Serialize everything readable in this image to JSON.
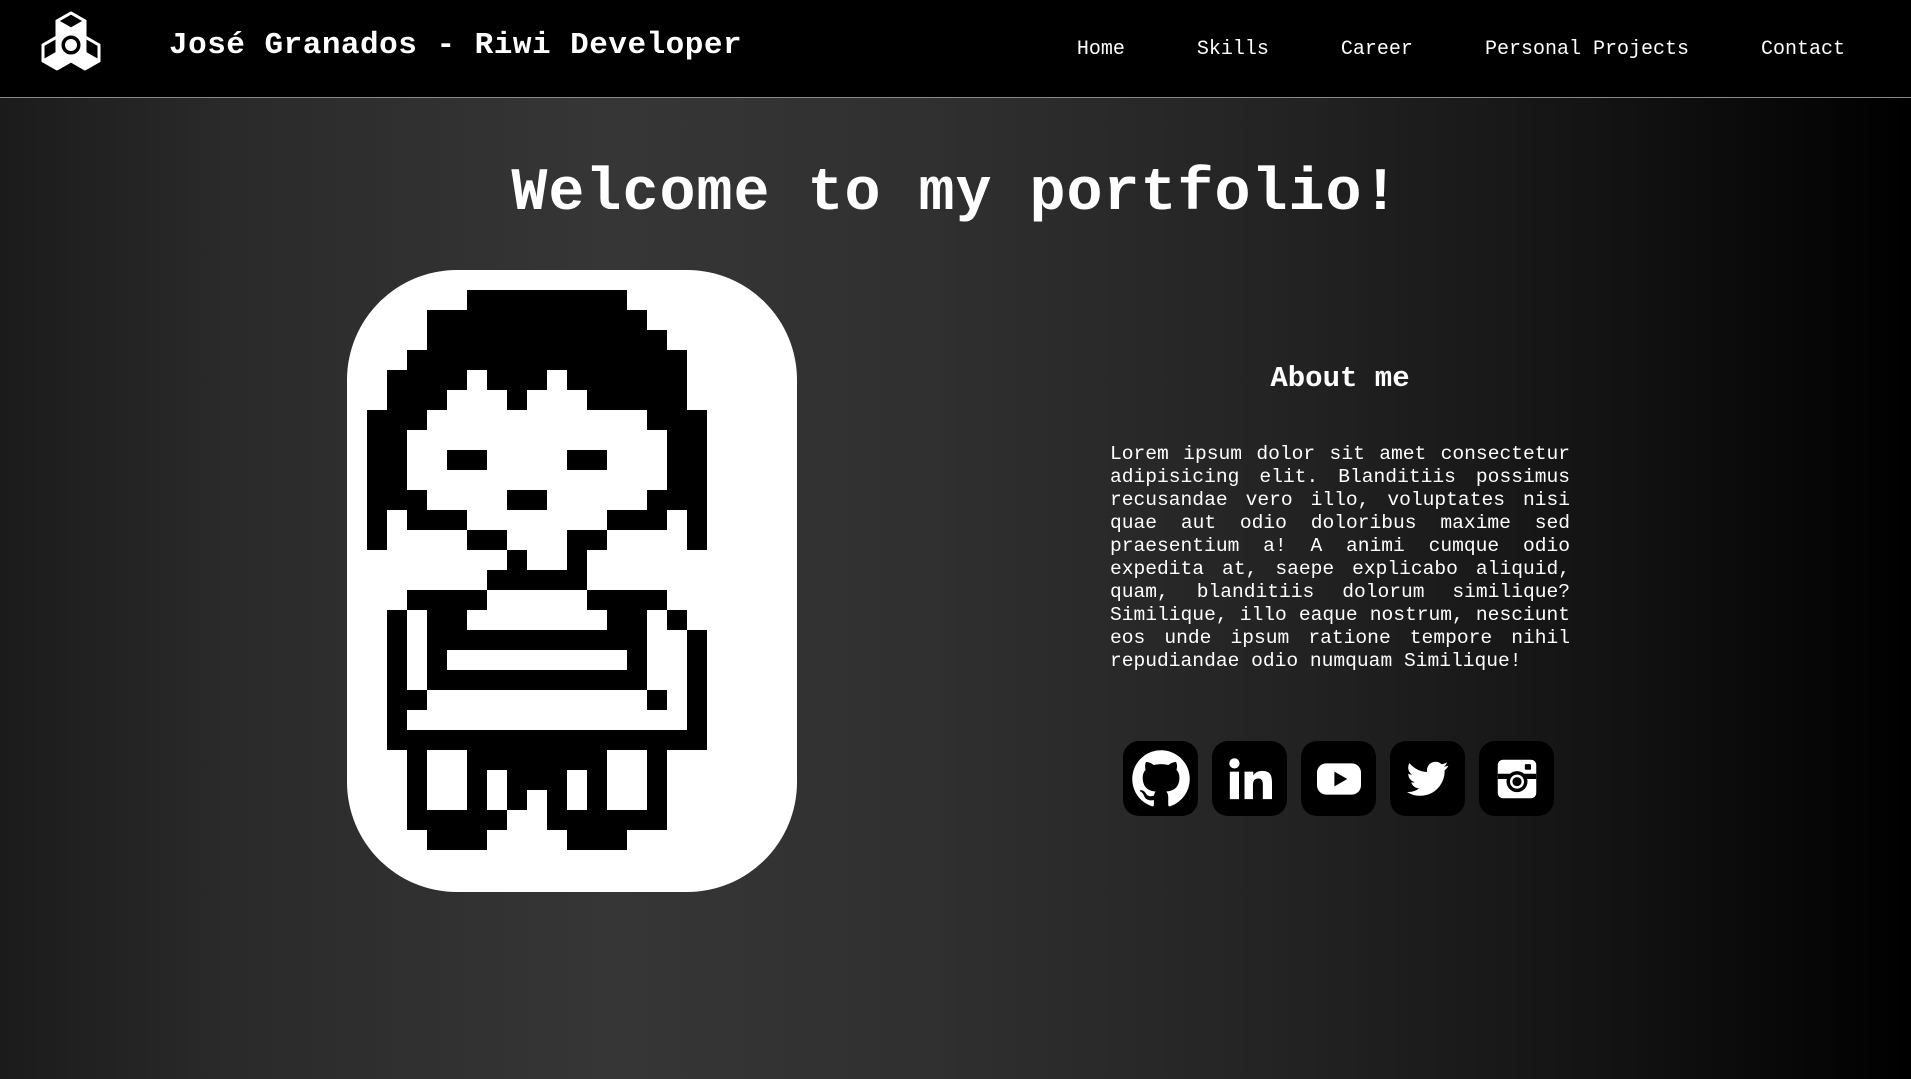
{
  "header": {
    "logo_icon": "hex-cube-logo-icon",
    "title": "José Granados - Riwi Developer",
    "nav": [
      {
        "label": "Home"
      },
      {
        "label": "Skills"
      },
      {
        "label": "Career"
      },
      {
        "label": "Personal Projects"
      },
      {
        "label": "Contact"
      }
    ]
  },
  "hero": {
    "heading": "Welcome to my portfolio!"
  },
  "avatar": {
    "icon": "pixel-art-avatar-icon"
  },
  "about": {
    "title": "About me",
    "text": "Lorem ipsum dolor sit amet consectetur adipisicing elit. Blanditiis possimus recusandae vero illo, voluptates nisi quae aut odio doloribus maxime sed praesentium a! A animi cumque odio expedita at, saepe explicabo aliquid, quam, blanditiis dolorum similique? Similique, illo eaque nostrum, nesciunt eos unde ipsum ratione tempore nihil repudiandae odio numquam Similique!"
  },
  "socials": [
    {
      "icon": "github-icon"
    },
    {
      "icon": "linkedin-icon"
    },
    {
      "icon": "youtube-icon"
    },
    {
      "icon": "twitter-icon"
    },
    {
      "icon": "instagram-icon"
    }
  ],
  "colors": {
    "navbar_bg": "#000000",
    "text": "#ffffff",
    "card_bg": "#ffffff",
    "social_bg": "#000000"
  }
}
